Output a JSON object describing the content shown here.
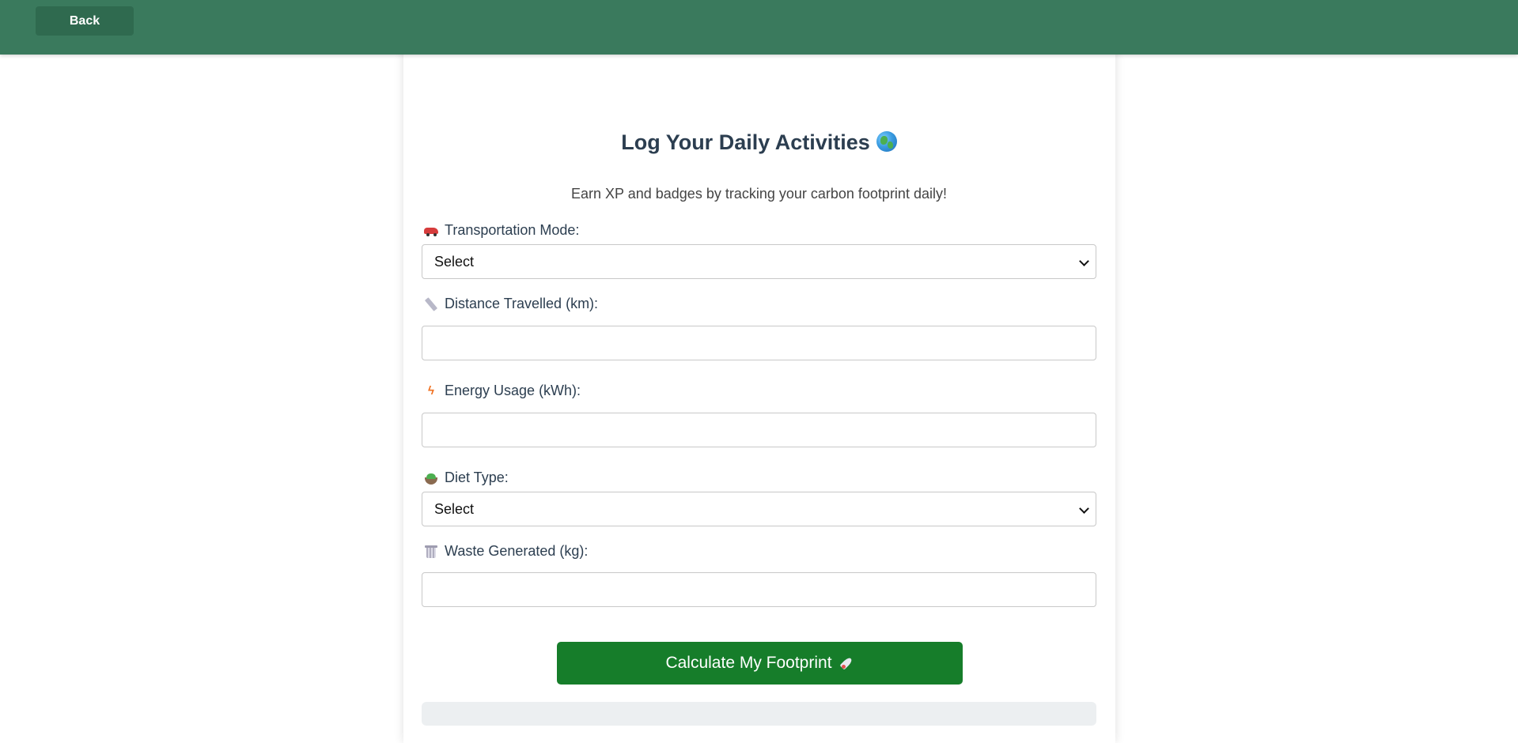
{
  "header": {
    "back_label": "Back"
  },
  "form": {
    "title": "Log Your Daily Activities",
    "subtitle": "Earn XP and badges by tracking your carbon footprint daily!",
    "fields": {
      "transportation": {
        "label": "Transportation Mode:",
        "icon": "car-icon",
        "value": "Select"
      },
      "distance": {
        "label": "Distance Travelled (km):",
        "icon": "ruler-icon",
        "value": ""
      },
      "energy": {
        "label": "Energy Usage (kWh):",
        "icon": "lightning-icon",
        "value": ""
      },
      "diet": {
        "label": "Diet Type:",
        "icon": "salad-icon",
        "value": "Select"
      },
      "waste": {
        "label": "Waste Generated (kg):",
        "icon": "trash-icon",
        "value": ""
      }
    },
    "submit_label": "Calculate My Footprint"
  },
  "colors": {
    "header_bg": "#3a7a5d",
    "back_button_bg": "#2f6a4f",
    "submit_bg": "#167d2a",
    "title_text": "#2c3e50"
  }
}
